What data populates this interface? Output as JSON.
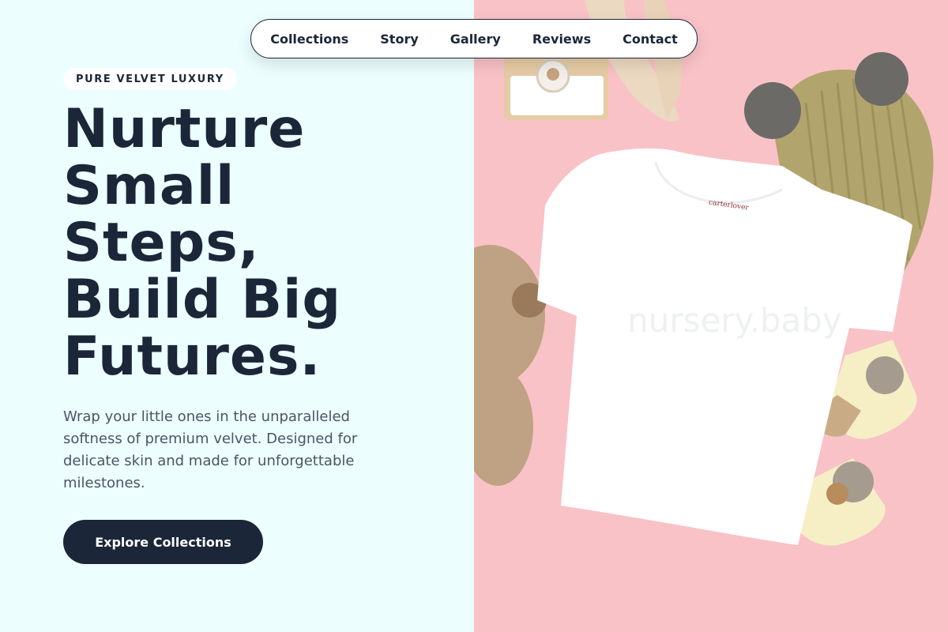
{
  "nav": {
    "items": [
      {
        "label": "Collections"
      },
      {
        "label": "Story"
      },
      {
        "label": "Gallery"
      },
      {
        "label": "Reviews"
      },
      {
        "label": "Contact"
      }
    ]
  },
  "hero": {
    "badge": "PURE VELVET LUXURY",
    "headline_lines": [
      "Nurture",
      "Small",
      "Steps,",
      "Build Big",
      "Futures."
    ],
    "description": "Wrap your little ones in the unparalleled softness of premium velvet. Designed for delicate skin and made for unforgettable milestones.",
    "cta_label": "Explore Collections"
  },
  "image": {
    "tag_text": "carterlover",
    "watermark": "nursery.baby"
  },
  "colors": {
    "left_bg": "#ecfefe",
    "right_bg": "#f9c2c6",
    "primary": "#1b2638",
    "text_muted": "#4b5563"
  }
}
